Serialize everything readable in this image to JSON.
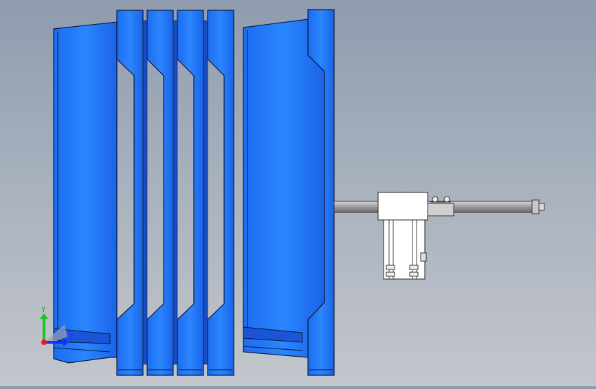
{
  "viewport": {
    "background_top": "#8f9cae",
    "background_bottom": "#c3c6cc"
  },
  "model": {
    "part_color": "#2680ff",
    "part_dark": "#1450d0",
    "edge_color": "#0a1a3a",
    "shaft_color": "#a7a7a7",
    "motor_color": "#ffffff"
  },
  "triad": {
    "y_label": "Y",
    "z_label": "Z",
    "y_color": "#20c020",
    "z_color": "#1a2cff",
    "origin_color": "#e02020"
  }
}
